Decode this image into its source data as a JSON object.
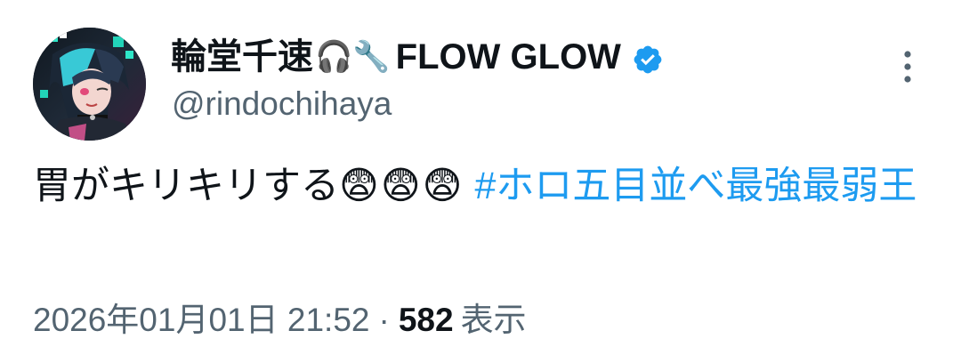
{
  "author": {
    "display_name_jp": "輪堂千速",
    "display_name_emoji": "🎧🔧",
    "display_name_latin": "FLOW GLOW",
    "verified": true,
    "handle": "@rindochihaya"
  },
  "tweet": {
    "text": "胃がキリキリする",
    "emoji": "😨😨😨",
    "hashtag": "#ホロ五目並べ最強最弱王"
  },
  "meta": {
    "timestamp": "2026年01月01日 21:52",
    "separator": "·",
    "views_count": "582",
    "views_label": "表示"
  },
  "colors": {
    "link": "#1d9bf0",
    "secondary_text": "#536471",
    "primary_text": "#0f1419"
  },
  "icons": {
    "avatar": "avatar",
    "verified": "verified-badge-icon",
    "more": "more-vertical-icon"
  }
}
